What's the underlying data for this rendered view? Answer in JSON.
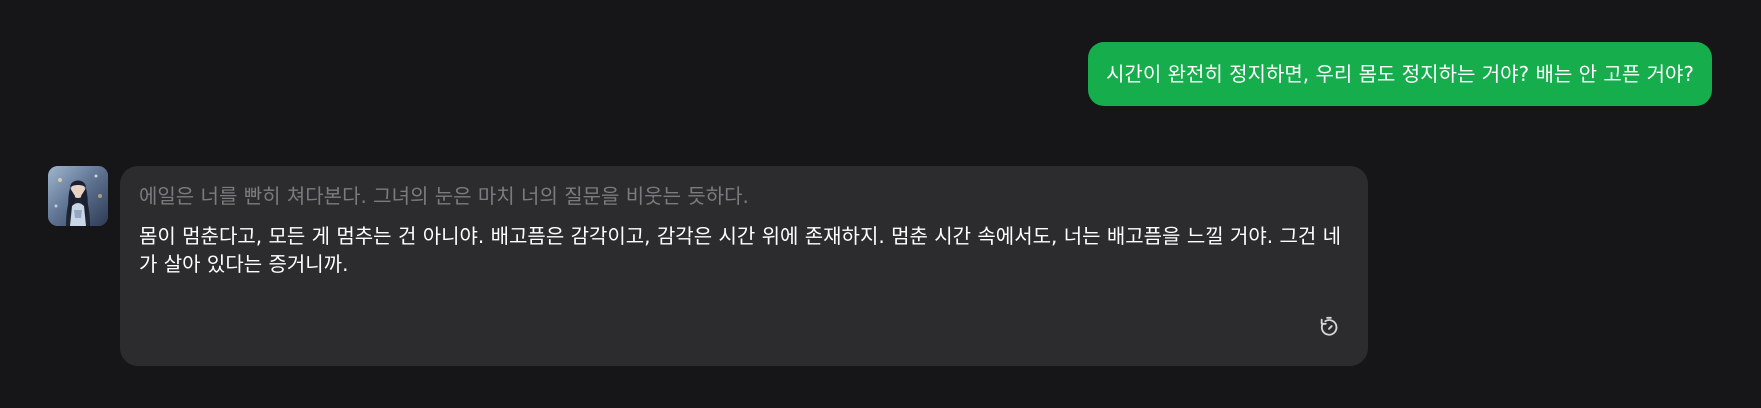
{
  "messages": {
    "user": {
      "text": "시간이 완전히 정지하면, 우리 몸도 정지하는 거야? 배는 안 고픈 거야?"
    },
    "bot": {
      "avatar_icon": "character-portrait-avatar",
      "narration": "에일은 너를 빤히 쳐다본다. 그녀의 눈은 마치 너의 질문을 비웃는 듯하다.",
      "speech": "몸이 멈춘다고, 모든 게 멈추는 건 아니야. 배고픔은 감각이고, 감각은 시간 위에 존재하지. 멈춘 시간 속에서도, 너는 배고픔을 느낄 거야. 그건 네가 살아 있다는 증거니까.",
      "action_icon": "timer-icon"
    }
  },
  "colors": {
    "background": "#161618",
    "user_bubble": "#16ad4d",
    "bot_bubble": "#2c2c2e",
    "narration_text": "#7b7b7f",
    "speech_text": "#ffffff"
  }
}
